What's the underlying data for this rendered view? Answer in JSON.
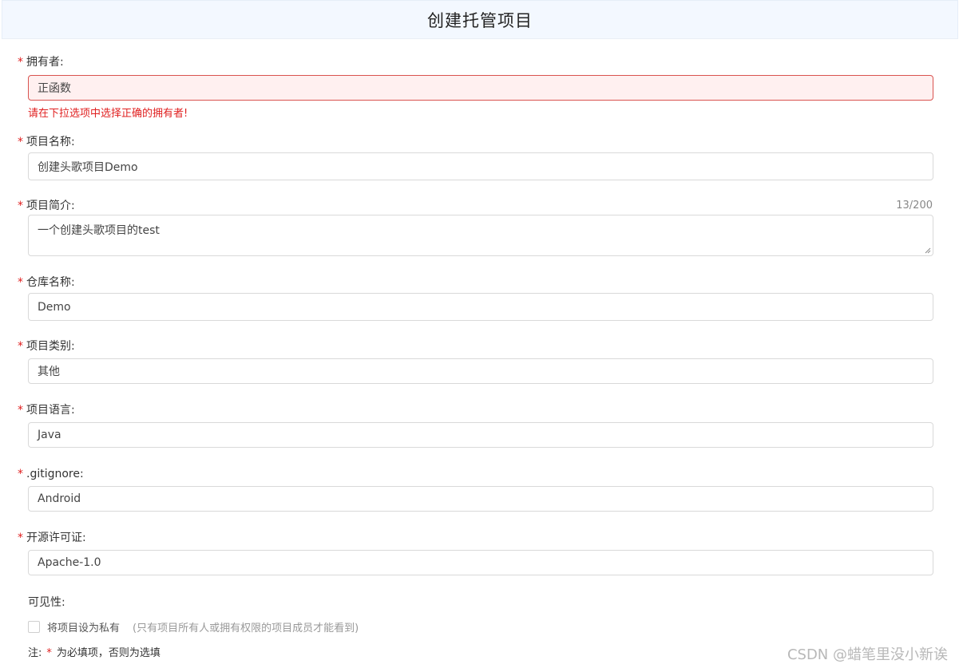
{
  "header": {
    "title": "创建托管项目"
  },
  "required_mark": "*",
  "owner": {
    "label": "拥有者:",
    "value": "正函数",
    "error": "请在下拉选项中选择正确的拥有者!"
  },
  "project_name": {
    "label": "项目名称:",
    "value": "创建头歌项目Demo"
  },
  "project_intro": {
    "label": "项目简介:",
    "value": "一个创建头歌项目的test",
    "counter": "13/200"
  },
  "repo_name": {
    "label": "仓库名称:",
    "value": "Demo"
  },
  "project_category": {
    "label": "项目类别:",
    "value": "其他"
  },
  "project_language": {
    "label": "项目语言:",
    "value": "Java"
  },
  "gitignore": {
    "label": ".gitignore:",
    "value": "Android"
  },
  "license": {
    "label": "开源许可证:",
    "value": "Apache-1.0"
  },
  "visibility": {
    "label": "可见性:",
    "checkbox_label": "将项目设为私有",
    "hint": "(只有项目所有人或拥有权限的项目成员才能看到)",
    "checked": false
  },
  "note": {
    "prefix": "注:",
    "suffix": "为必填项，否则为选填"
  },
  "watermark": "CSDN @蜡笔里没小新诶"
}
